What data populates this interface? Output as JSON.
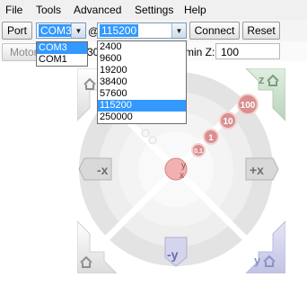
{
  "menu": [
    "File",
    "Tools",
    "Advanced",
    "Settings",
    "Help"
  ],
  "toolbar": {
    "port_label": "Port",
    "port_selected": "COM3",
    "at_symbol": "@",
    "baud_selected": "115200",
    "connect_label": "Connect",
    "reset_label": "Reset"
  },
  "row2": {
    "motors_partial": "Motor",
    "value_partial": "30",
    "min_z_label": "min Z:",
    "min_z_value": "100"
  },
  "port_options": [
    "COM3",
    "COM1"
  ],
  "baud_options": [
    "2400",
    "9600",
    "19200",
    "38400",
    "57600",
    "115200",
    "250000"
  ],
  "jog": {
    "minus_x": "-x",
    "plus_x": "+x",
    "minus_y": "-y",
    "y_label": "y",
    "z_label": "z",
    "center_y": "y",
    "center_x": "x",
    "steps": [
      "100",
      "10",
      "1",
      "0,1"
    ]
  },
  "colors": {
    "selection": "#3399ff",
    "step_circle": "#d98f8f",
    "accent_pink": "#f3b0b0"
  }
}
